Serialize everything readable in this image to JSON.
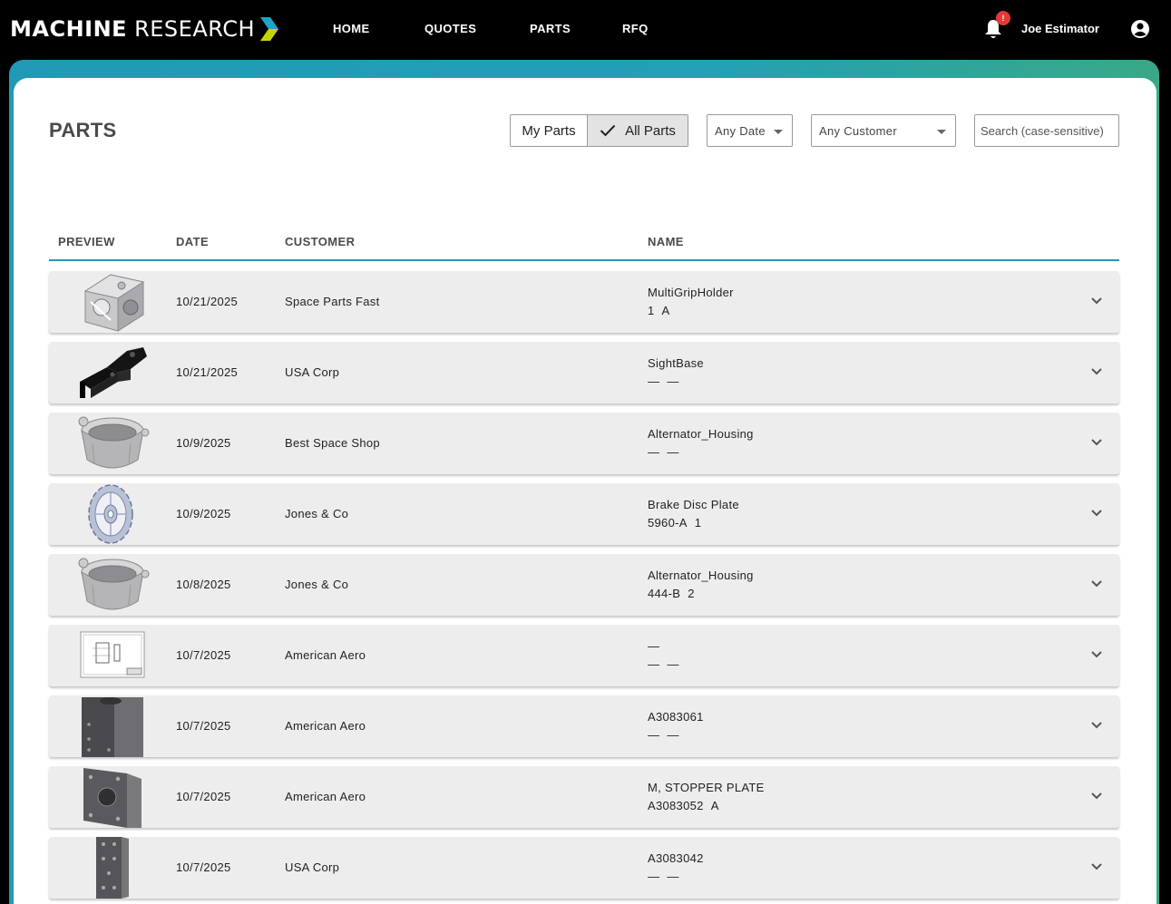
{
  "header": {
    "logo_bold": "MACHINE",
    "logo_light": "RESEARCH",
    "nav": [
      "HOME",
      "QUOTES",
      "PARTS",
      "RFQ"
    ],
    "notification_badge": "!",
    "user_name": "Joe Estimator"
  },
  "page": {
    "title": "PARTS"
  },
  "filters": {
    "my_parts": "My Parts",
    "all_parts": "All Parts",
    "date": "Any Date",
    "customer": "Any Customer",
    "search_placeholder": "Search (case-sensitive)"
  },
  "table": {
    "columns": [
      "PREVIEW",
      "DATE",
      "CUSTOMER",
      "NAME"
    ],
    "rows": [
      {
        "thumb": "multigrip-holder-3d",
        "date": "10/21/2025",
        "customer": "Space Parts Fast",
        "name": "MultiGripHolder",
        "part": "1",
        "rev": "A"
      },
      {
        "thumb": "sight-base-3d",
        "date": "10/21/2025",
        "customer": "USA Corp",
        "name": "SightBase",
        "part": "—",
        "rev": "—"
      },
      {
        "thumb": "alternator-housing-3d",
        "date": "10/9/2025",
        "customer": "Best Space Shop",
        "name": "Alternator_Housing",
        "part": "—",
        "rev": "—"
      },
      {
        "thumb": "brake-disc-3d",
        "date": "10/9/2025",
        "customer": "Jones & Co",
        "name": "Brake Disc Plate",
        "part": "5960-A",
        "rev": "1"
      },
      {
        "thumb": "alternator-housing-3d",
        "date": "10/8/2025",
        "customer": "Jones & Co",
        "name": "Alternator_Housing",
        "part": "444-B",
        "rev": "2"
      },
      {
        "thumb": "drawing-sheet",
        "date": "10/7/2025",
        "customer": "American Aero",
        "name": "—",
        "part": "—",
        "rev": "—"
      },
      {
        "thumb": "block-3d",
        "date": "10/7/2025",
        "customer": "American Aero",
        "name": "A3083061",
        "part": "—",
        "rev": "—"
      },
      {
        "thumb": "stopper-plate-3d",
        "date": "10/7/2025",
        "customer": "American Aero",
        "name": "M, STOPPER PLATE",
        "part": "A3083052",
        "rev": "A"
      },
      {
        "thumb": "bar-3d",
        "date": "10/7/2025",
        "customer": "USA Corp",
        "name": "A3083042",
        "part": "—",
        "rev": "—"
      }
    ]
  },
  "colors": {
    "accent": "#2199b6",
    "accent_green": "#3aa887",
    "row_bg": "#ededed",
    "badge": "#e53935"
  }
}
